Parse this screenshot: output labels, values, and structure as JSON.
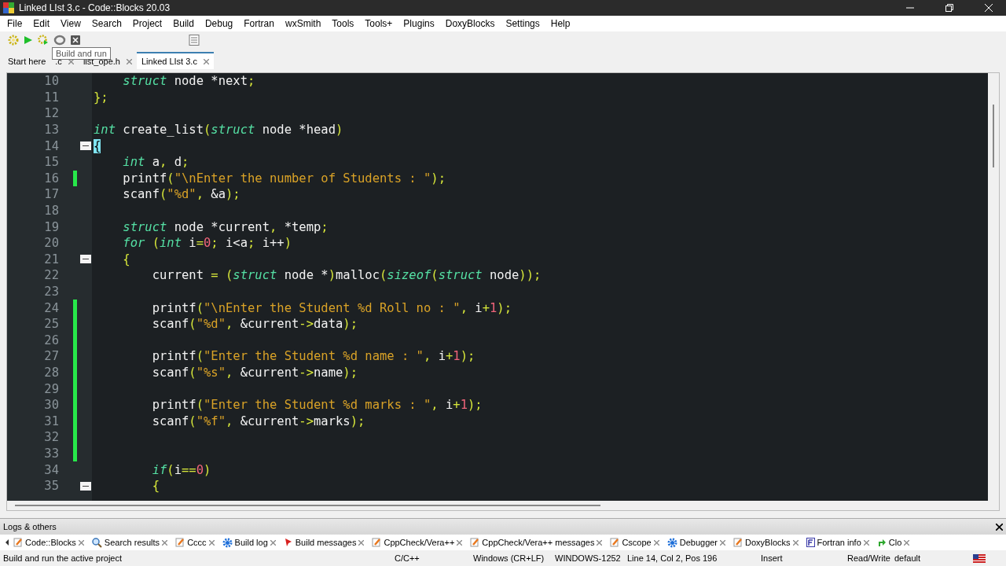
{
  "window": {
    "title": "Linked LIst 3.c - Code::Blocks 20.03"
  },
  "menu": [
    "File",
    "Edit",
    "View",
    "Search",
    "Project",
    "Build",
    "Debug",
    "Fortran",
    "wxSmith",
    "Tools",
    "Tools+",
    "Plugins",
    "DoxyBlocks",
    "Settings",
    "Help"
  ],
  "toolbar": {
    "tooltip": "Build and run"
  },
  "editor_tabs": [
    {
      "label": "Start here",
      "closable": false,
      "selected": false
    },
    {
      "label": ".c",
      "closable": true,
      "selected": false
    },
    {
      "label": "list_ope.h",
      "closable": true,
      "selected": false
    },
    {
      "label": "Linked LIst 3.c",
      "closable": true,
      "selected": true
    }
  ],
  "code_lines": [
    {
      "number": "10",
      "changed": false,
      "fold": false,
      "tokens": [
        {
          "kind": "kw",
          "text": "    struct"
        },
        {
          "kind": "id",
          "text": " node *next"
        },
        {
          "kind": "p",
          "text": ";"
        }
      ]
    },
    {
      "number": "11",
      "changed": false,
      "fold": false,
      "tokens": [
        {
          "kind": "p",
          "text": "};"
        }
      ]
    },
    {
      "number": "12",
      "changed": false,
      "fold": false
    },
    {
      "number": "13",
      "changed": false,
      "fold": false,
      "tokens": [
        {
          "kind": "kw",
          "text": "int"
        },
        {
          "kind": "id",
          "text": " create_list"
        },
        {
          "kind": "p",
          "text": "("
        },
        {
          "kind": "kw",
          "text": "struct"
        },
        {
          "kind": "id",
          "text": " node *head"
        },
        {
          "kind": "p",
          "text": ")"
        }
      ]
    },
    {
      "number": "14",
      "changed": false,
      "fold": true,
      "tokens": [
        {
          "kind": "match",
          "text": "{"
        }
      ]
    },
    {
      "number": "15",
      "changed": false,
      "fold": false,
      "tokens": [
        {
          "kind": "kw",
          "text": "    int"
        },
        {
          "kind": "id",
          "text": " a"
        },
        {
          "kind": "p",
          "text": ", "
        },
        {
          "kind": "id",
          "text": "d"
        },
        {
          "kind": "p",
          "text": ";"
        }
      ]
    },
    {
      "number": "16",
      "changed": true,
      "fold": false,
      "tokens": [
        {
          "kind": "id",
          "text": "    printf"
        },
        {
          "kind": "p",
          "text": "("
        },
        {
          "kind": "str",
          "text": "\"\\nEnter the number of Students : \""
        },
        {
          "kind": "p",
          "text": ");"
        }
      ]
    },
    {
      "number": "17",
      "changed": false,
      "fold": false,
      "tokens": [
        {
          "kind": "id",
          "text": "    scanf"
        },
        {
          "kind": "p",
          "text": "("
        },
        {
          "kind": "str",
          "text": "\"%d\""
        },
        {
          "kind": "p",
          "text": ", "
        },
        {
          "kind": "id",
          "text": "&a"
        },
        {
          "kind": "p",
          "text": ");"
        }
      ]
    },
    {
      "number": "18",
      "changed": false,
      "fold": false
    },
    {
      "number": "19",
      "changed": false,
      "fold": false,
      "tokens": [
        {
          "kind": "kw",
          "text": "    struct"
        },
        {
          "kind": "id",
          "text": " node *current"
        },
        {
          "kind": "p",
          "text": ", "
        },
        {
          "kind": "id",
          "text": "*temp"
        },
        {
          "kind": "p",
          "text": ";"
        }
      ]
    },
    {
      "number": "20",
      "changed": false,
      "fold": false,
      "tokens": [
        {
          "kind": "kw",
          "text": "    for"
        },
        {
          "kind": "p",
          "text": " ("
        },
        {
          "kind": "kw",
          "text": "int"
        },
        {
          "kind": "id",
          "text": " i"
        },
        {
          "kind": "p",
          "text": "="
        },
        {
          "kind": "num",
          "text": "0"
        },
        {
          "kind": "p",
          "text": "; "
        },
        {
          "kind": "id",
          "text": "i<a"
        },
        {
          "kind": "p",
          "text": "; "
        },
        {
          "kind": "id",
          "text": "i++"
        },
        {
          "kind": "p",
          "text": ")"
        }
      ]
    },
    {
      "number": "21",
      "changed": false,
      "fold": true,
      "tokens": [
        {
          "kind": "p",
          "text": "    {"
        }
      ]
    },
    {
      "number": "22",
      "changed": false,
      "fold": false,
      "tokens": [
        {
          "kind": "id",
          "text": "        current "
        },
        {
          "kind": "p",
          "text": "= ("
        },
        {
          "kind": "kw",
          "text": "struct"
        },
        {
          "kind": "id",
          "text": " node *"
        },
        {
          "kind": "p",
          "text": ")"
        },
        {
          "kind": "id",
          "text": "malloc"
        },
        {
          "kind": "p",
          "text": "("
        },
        {
          "kind": "kw",
          "text": "sizeof"
        },
        {
          "kind": "p",
          "text": "("
        },
        {
          "kind": "kw",
          "text": "struct"
        },
        {
          "kind": "id",
          "text": " node"
        },
        {
          "kind": "p",
          "text": "));"
        }
      ]
    },
    {
      "number": "23",
      "changed": false,
      "fold": false
    },
    {
      "number": "24",
      "changed": true,
      "fold": false,
      "tokens": [
        {
          "kind": "id",
          "text": "        printf"
        },
        {
          "kind": "p",
          "text": "("
        },
        {
          "kind": "str",
          "text": "\"\\nEnter the Student %d Roll no : \""
        },
        {
          "kind": "p",
          "text": ", "
        },
        {
          "kind": "id",
          "text": "i"
        },
        {
          "kind": "p",
          "text": "+"
        },
        {
          "kind": "num",
          "text": "1"
        },
        {
          "kind": "p",
          "text": ");"
        }
      ]
    },
    {
      "number": "25",
      "changed": true,
      "fold": false,
      "tokens": [
        {
          "kind": "id",
          "text": "        scanf"
        },
        {
          "kind": "p",
          "text": "("
        },
        {
          "kind": "str",
          "text": "\"%d\""
        },
        {
          "kind": "p",
          "text": ", "
        },
        {
          "kind": "id",
          "text": "&current"
        },
        {
          "kind": "p",
          "text": "->"
        },
        {
          "kind": "id",
          "text": "data"
        },
        {
          "kind": "p",
          "text": ");"
        }
      ]
    },
    {
      "number": "26",
      "changed": true,
      "fold": false
    },
    {
      "number": "27",
      "changed": true,
      "fold": false,
      "tokens": [
        {
          "kind": "id",
          "text": "        printf"
        },
        {
          "kind": "p",
          "text": "("
        },
        {
          "kind": "str",
          "text": "\"Enter the Student %d name : \""
        },
        {
          "kind": "p",
          "text": ", "
        },
        {
          "kind": "id",
          "text": "i"
        },
        {
          "kind": "p",
          "text": "+"
        },
        {
          "kind": "num",
          "text": "1"
        },
        {
          "kind": "p",
          "text": ");"
        }
      ]
    },
    {
      "number": "28",
      "changed": true,
      "fold": false,
      "tokens": [
        {
          "kind": "id",
          "text": "        scanf"
        },
        {
          "kind": "p",
          "text": "("
        },
        {
          "kind": "str",
          "text": "\"%s\""
        },
        {
          "kind": "p",
          "text": ", "
        },
        {
          "kind": "id",
          "text": "&current"
        },
        {
          "kind": "p",
          "text": "->"
        },
        {
          "kind": "id",
          "text": "name"
        },
        {
          "kind": "p",
          "text": ");"
        }
      ]
    },
    {
      "number": "29",
      "changed": true,
      "fold": false
    },
    {
      "number": "30",
      "changed": true,
      "fold": false,
      "tokens": [
        {
          "kind": "id",
          "text": "        printf"
        },
        {
          "kind": "p",
          "text": "("
        },
        {
          "kind": "str",
          "text": "\"Enter the Student %d marks : \""
        },
        {
          "kind": "p",
          "text": ", "
        },
        {
          "kind": "id",
          "text": "i"
        },
        {
          "kind": "p",
          "text": "+"
        },
        {
          "kind": "num",
          "text": "1"
        },
        {
          "kind": "p",
          "text": ");"
        }
      ]
    },
    {
      "number": "31",
      "changed": true,
      "fold": false,
      "tokens": [
        {
          "kind": "id",
          "text": "        scanf"
        },
        {
          "kind": "p",
          "text": "("
        },
        {
          "kind": "str",
          "text": "\"%f\""
        },
        {
          "kind": "p",
          "text": ", "
        },
        {
          "kind": "id",
          "text": "&current"
        },
        {
          "kind": "p",
          "text": "->"
        },
        {
          "kind": "id",
          "text": "marks"
        },
        {
          "kind": "p",
          "text": ");"
        }
      ]
    },
    {
      "number": "32",
      "changed": true,
      "fold": false
    },
    {
      "number": "33",
      "changed": true,
      "fold": false
    },
    {
      "number": "34",
      "changed": false,
      "fold": false,
      "tokens": [
        {
          "kind": "kw",
          "text": "        if"
        },
        {
          "kind": "p",
          "text": "("
        },
        {
          "kind": "id",
          "text": "i"
        },
        {
          "kind": "p",
          "text": "=="
        },
        {
          "kind": "num",
          "text": "0"
        },
        {
          "kind": "p",
          "text": ")"
        }
      ]
    },
    {
      "number": "35",
      "changed": false,
      "fold": true,
      "tokens": [
        {
          "kind": "p",
          "text": "        {"
        }
      ]
    }
  ],
  "logs_panel": {
    "title": "Logs & others",
    "tabs": [
      {
        "label": "Code::Blocks",
        "kind": "pencil"
      },
      {
        "label": "Search results",
        "kind": "search"
      },
      {
        "label": "Cccc",
        "kind": "pencil"
      },
      {
        "label": "Build log",
        "kind": "gear"
      },
      {
        "label": "Build messages",
        "kind": "pin"
      },
      {
        "label": "CppCheck/Vera++",
        "kind": "pencil"
      },
      {
        "label": "CppCheck/Vera++ messages",
        "kind": "pencil"
      },
      {
        "label": "Cscope",
        "kind": "pencil"
      },
      {
        "label": "Debugger",
        "kind": "gear"
      },
      {
        "label": "DoxyBlocks",
        "kind": "pencil"
      },
      {
        "label": "Fortran info",
        "kind": "doc"
      },
      {
        "label": "Clo",
        "kind": "arrow"
      }
    ]
  },
  "status_bar": {
    "message": "Build and run the active project",
    "fields": [
      "C/C++",
      "Windows (CR+LF)",
      "WINDOWS-1252",
      "Line 14, Col 2, Pos 196",
      "Insert",
      "Read/Write",
      "default"
    ]
  }
}
